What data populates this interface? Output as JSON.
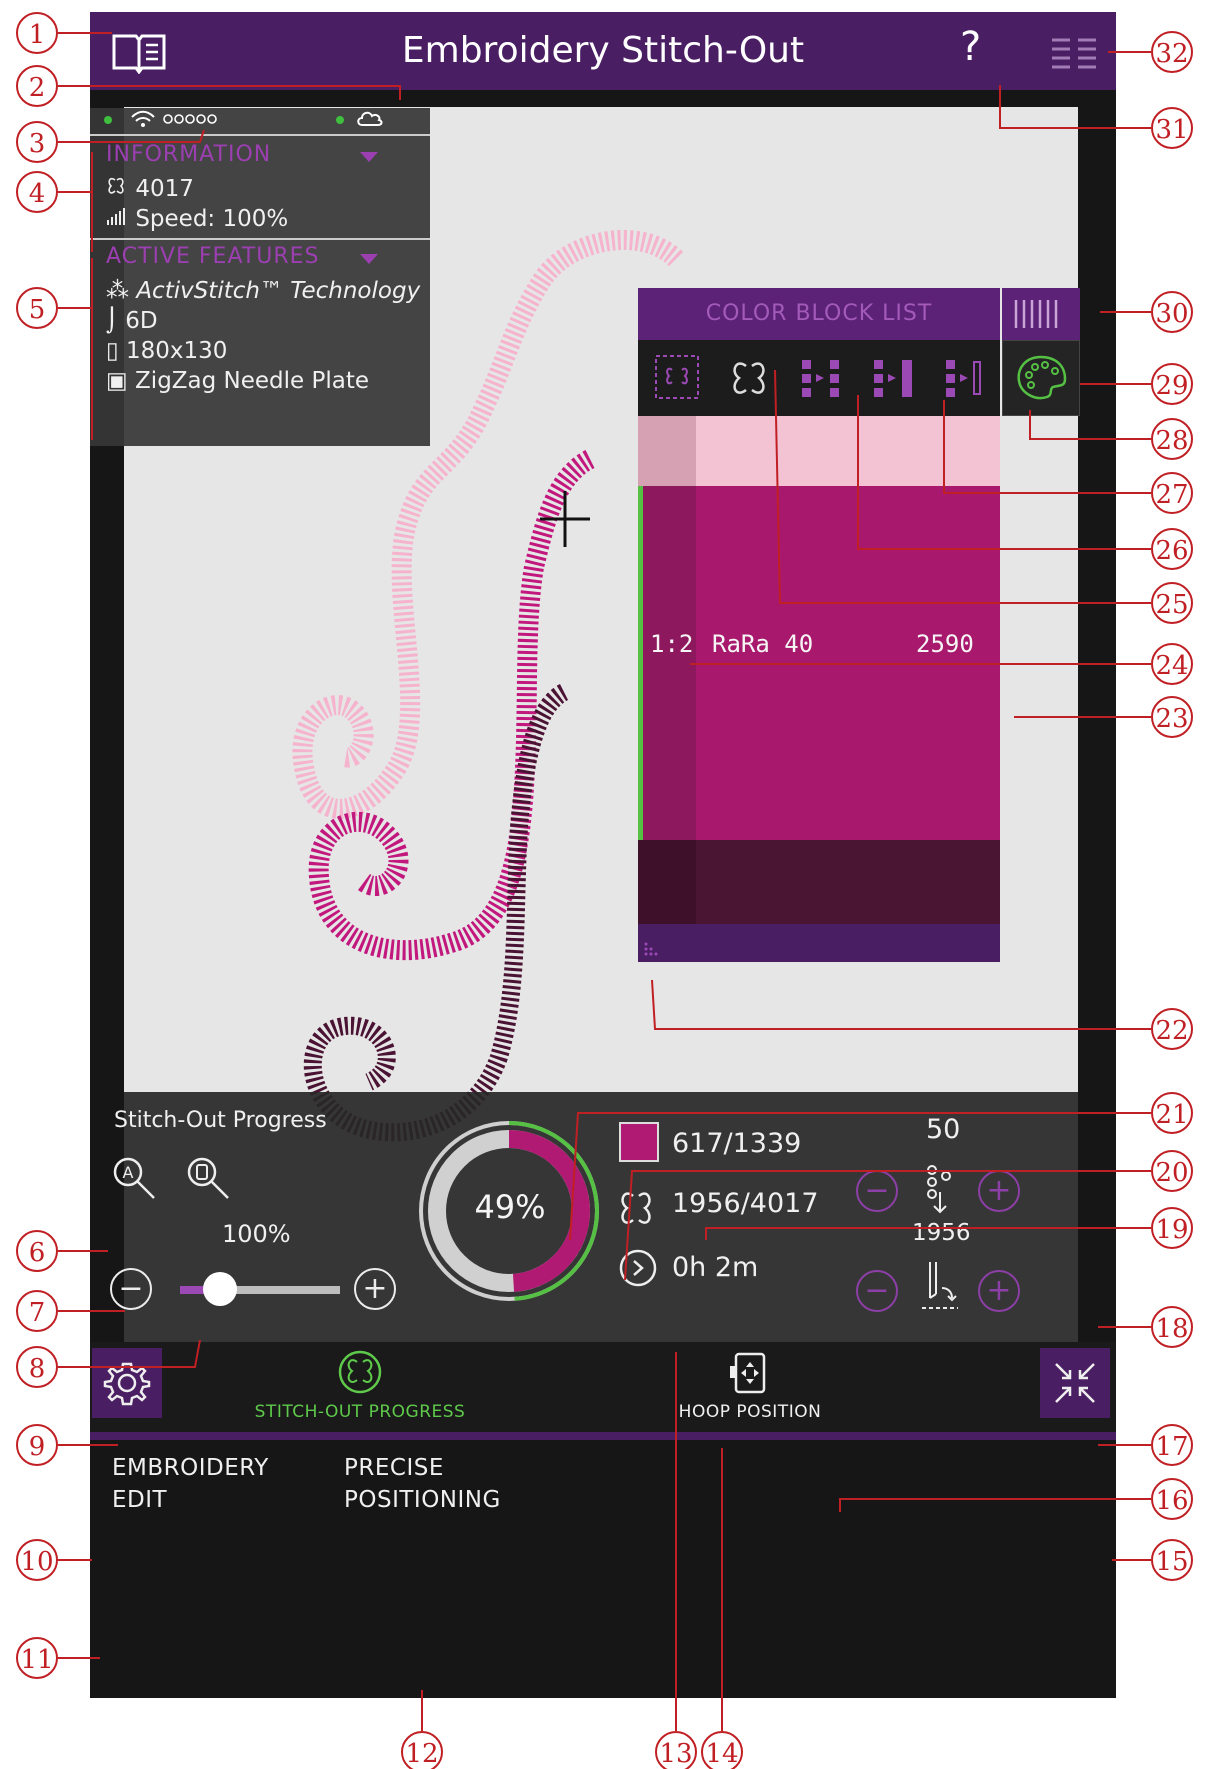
{
  "app": {
    "title": "Embroidery Stitch-Out"
  },
  "header": {
    "help_label": "?",
    "icons": [
      "manual-book-icon",
      "help-icon",
      "menu-icon"
    ]
  },
  "info_panel": {
    "status": {
      "wifi": "wifi-icon",
      "signal": "signal-strength-icon",
      "cloud": "cloud-icon",
      "status_color": "#3ec03e"
    },
    "information": {
      "heading": "INFORMATION",
      "stitch_count": "4017",
      "speed": "Speed: 100%"
    },
    "active_features": {
      "heading": "ACTIVE FEATURES",
      "items": [
        {
          "icon": "activstitch-icon",
          "label": "ActivStitch™ Technology"
        },
        {
          "icon": "presser-foot-icon",
          "label": "6D"
        },
        {
          "icon": "hoop-icon",
          "label": "180x130"
        },
        {
          "icon": "needle-plate-icon",
          "label": "ZigZag Needle Plate"
        }
      ]
    }
  },
  "color_block_list": {
    "title": "COLOR BLOCK LIST",
    "tabs": [
      "design-view-icon",
      "stitch-butterfly-icon",
      "block-step-icon",
      "block-step-forward-icon",
      "block-step-end-icon"
    ],
    "blocks": [
      {
        "color": "#f3c3d3",
        "index": "",
        "thread": "",
        "stitches": ""
      },
      {
        "color": "#a8196d",
        "index": "1:2",
        "thread": "RaRa 40",
        "stitches": "2590",
        "active": true
      },
      {
        "color": "#4a1433",
        "index": "",
        "thread": "",
        "stitches": ""
      }
    ]
  },
  "progress": {
    "label": "Stitch-Out Progress",
    "zoom_value": "100%",
    "zoom_fraction": 0.25,
    "percent_label": "49%",
    "percent": 49,
    "color_block_progress": "617/1339",
    "stitch_progress": "1956/4017",
    "time_left": "0h 2m",
    "speed_value": "50",
    "stitch_position": "1956",
    "colors": {
      "accent": "#b01a73",
      "ring_green": "#55c043",
      "ring_gray": "#d0d0d0"
    }
  },
  "nav": {
    "stitch_out_progress": "STITCH-OUT PROGRESS",
    "hoop_position": "HOOP POSITION"
  },
  "bottom_tabs": {
    "embroidery_edit_line1": "EMBROIDERY",
    "embroidery_edit_line2": "EDIT",
    "precise_line1": "PRECISE",
    "precise_line2": "POSITIONING"
  },
  "callouts": [
    "1",
    "2",
    "3",
    "4",
    "5",
    "6",
    "7",
    "8",
    "9",
    "10",
    "11",
    "12",
    "13",
    "14",
    "15",
    "16",
    "17",
    "18",
    "19",
    "20",
    "21",
    "22",
    "23",
    "24",
    "25",
    "26",
    "27",
    "28",
    "29",
    "30",
    "31",
    "32"
  ]
}
